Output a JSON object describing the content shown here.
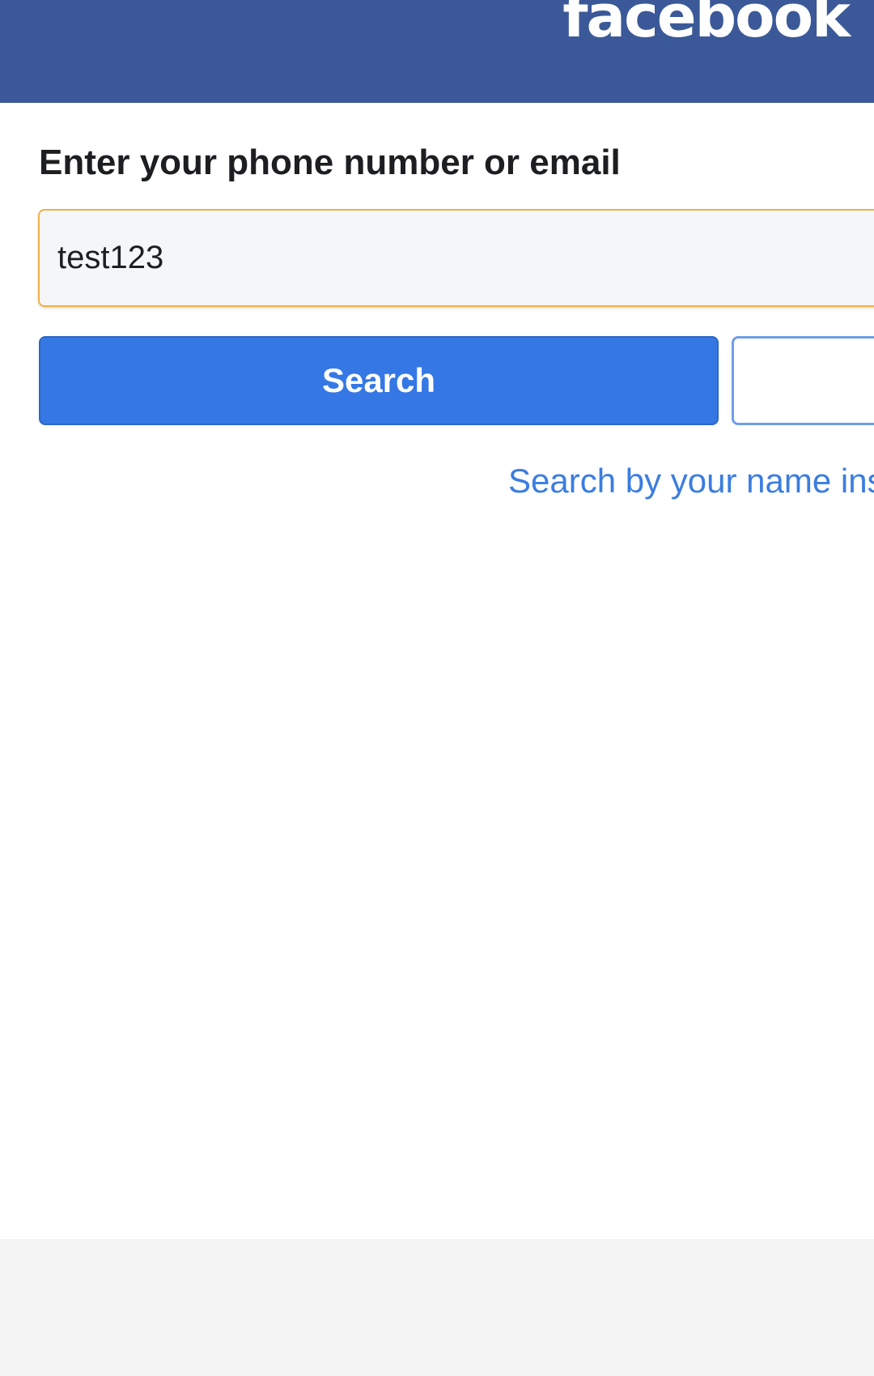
{
  "header": {
    "logo_text": "facebook",
    "background_color": "#3b5998"
  },
  "form": {
    "prompt": "Enter your phone number or email",
    "input_value": "test123",
    "search_label": "Search",
    "alt_link_text": "Search by your name ins"
  },
  "colors": {
    "primary_button": "#3578e5",
    "link": "#3b7de0",
    "input_focus_border": "#f0b048"
  }
}
